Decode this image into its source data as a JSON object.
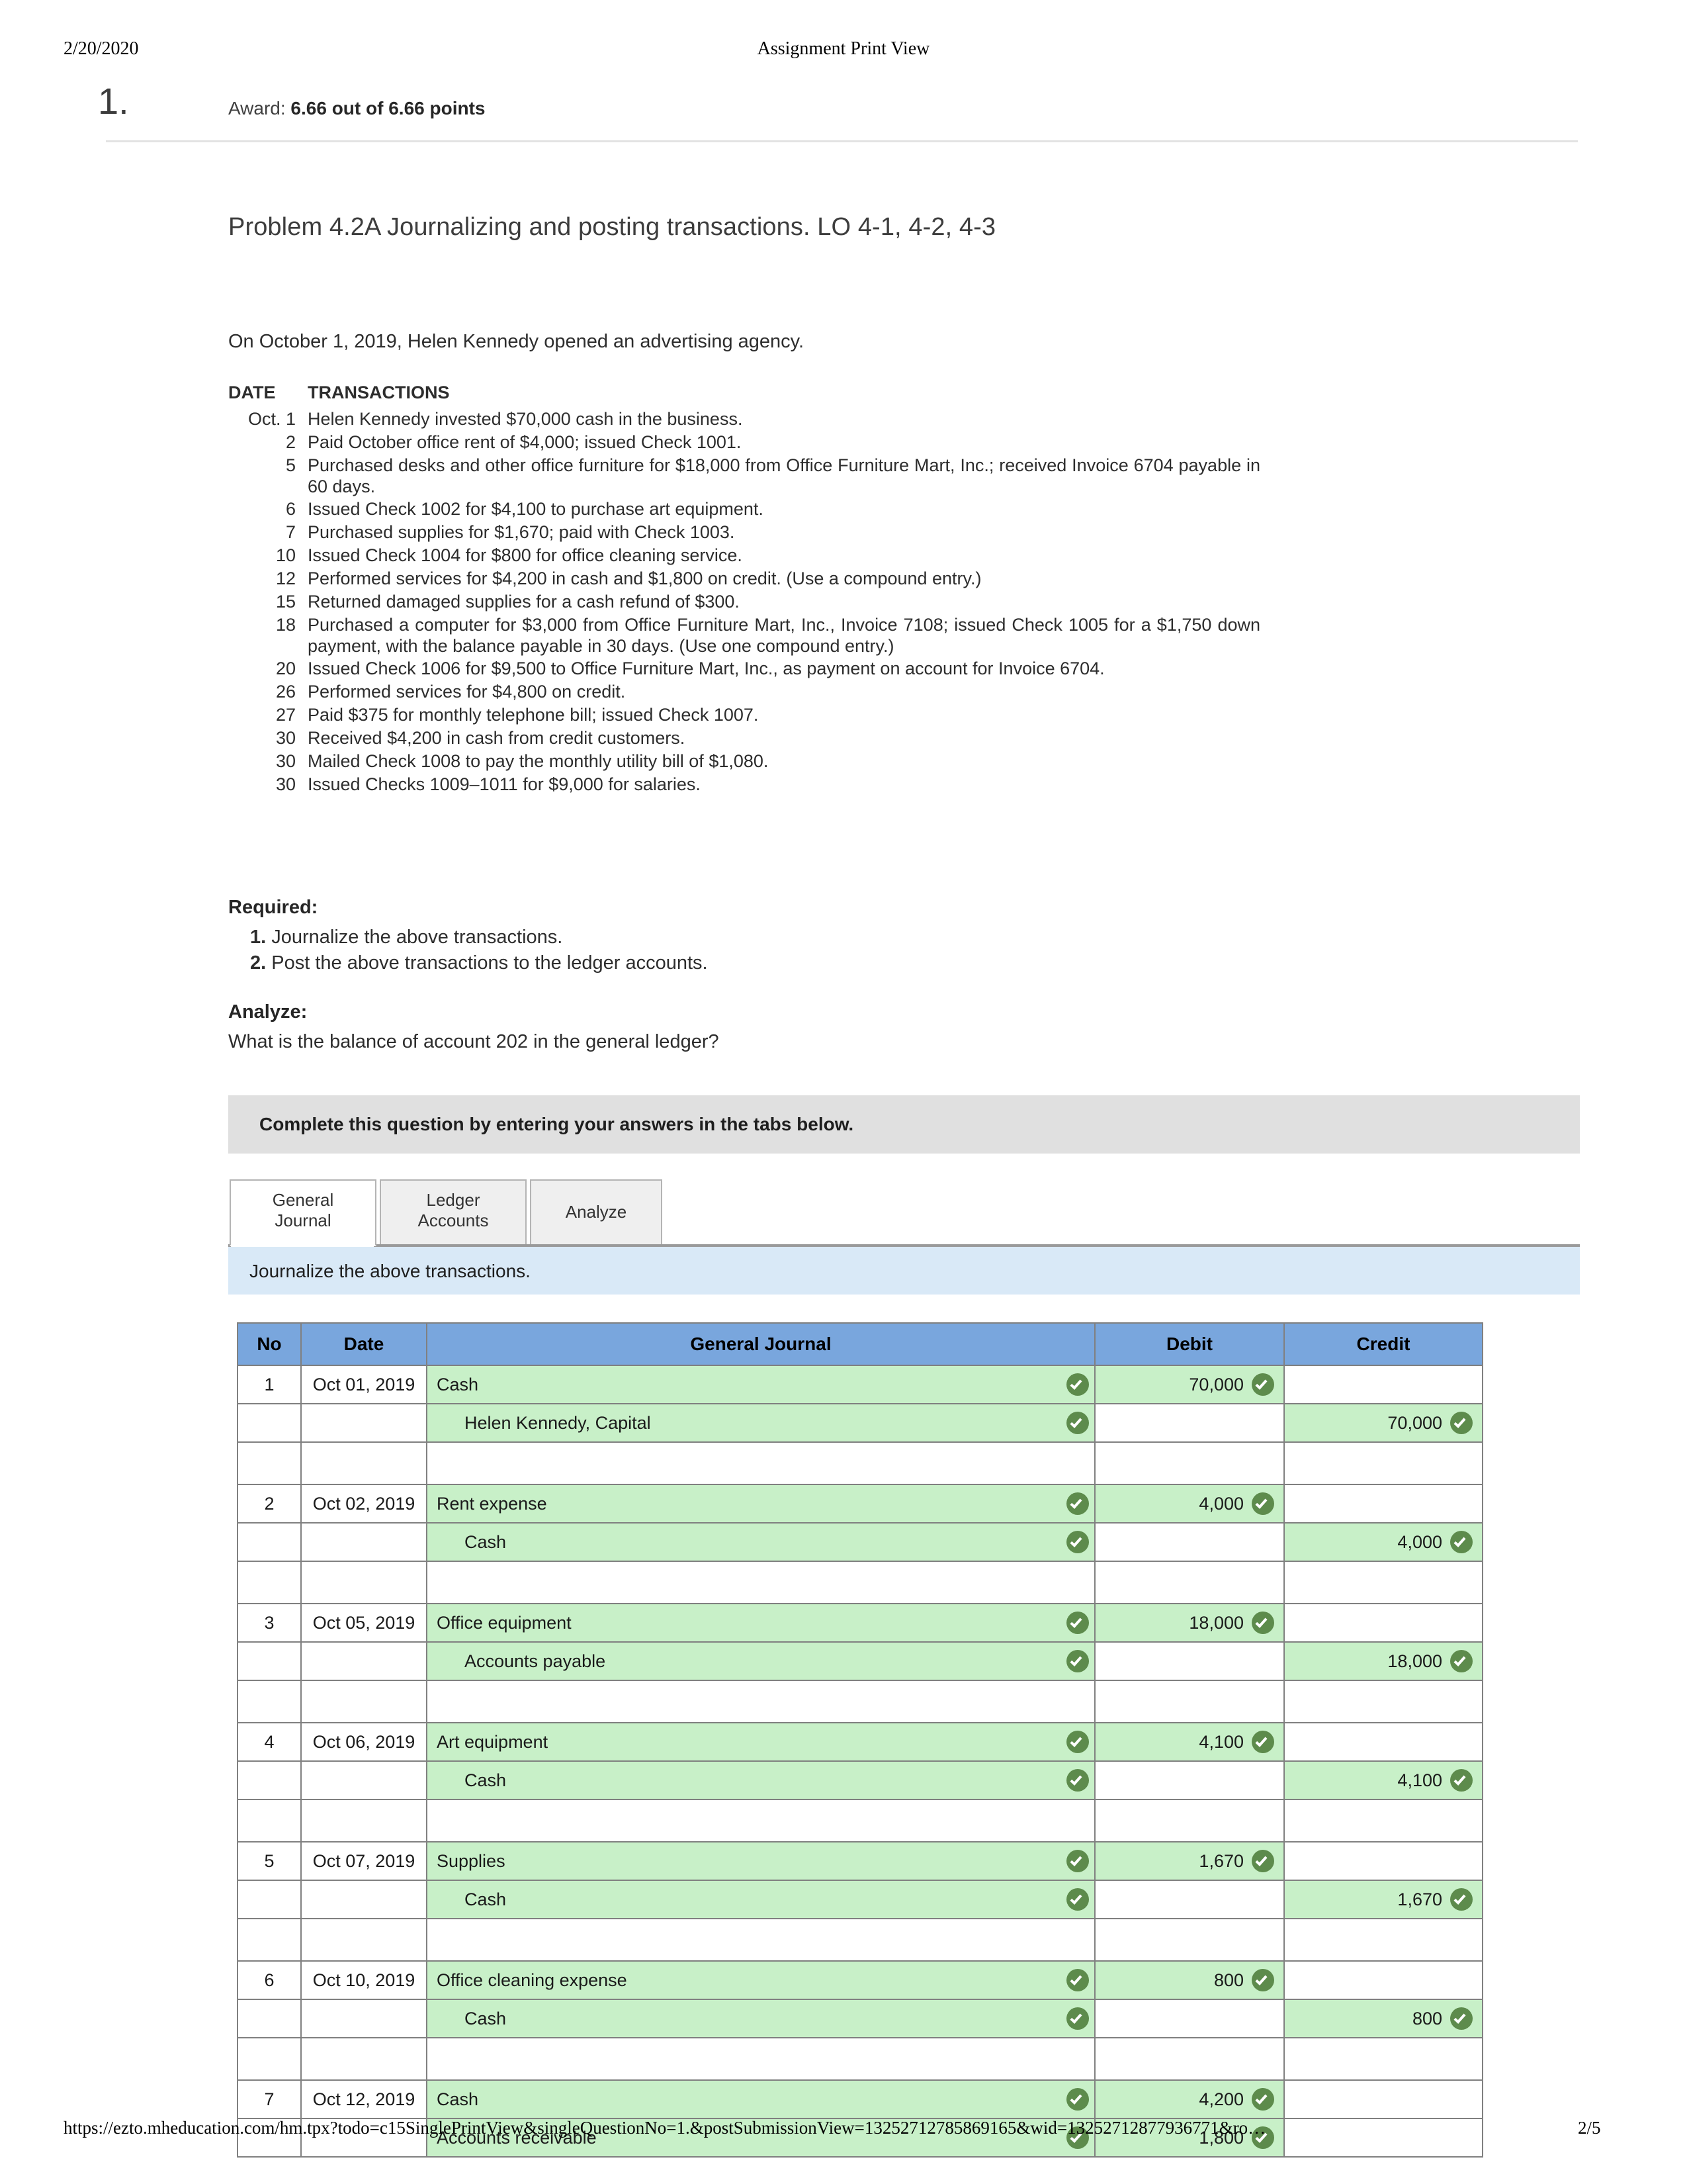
{
  "print_header": {
    "date": "2/20/2020",
    "title": "Assignment Print View"
  },
  "question": {
    "number": "1.",
    "award_label": "Award:",
    "award_value": "6.66 out of 6.66 points"
  },
  "problem": {
    "title": "Problem 4.2A Journalizing and posting transactions. LO 4-1, 4-2, 4-3",
    "intro": "On October 1, 2019, Helen Kennedy opened an advertising agency.",
    "tx_header_date": "DATE",
    "tx_header_transactions": "TRANSACTIONS",
    "transactions": [
      {
        "date": "Oct. 1",
        "text": "Helen Kennedy invested $70,000 cash in the business."
      },
      {
        "date": "2",
        "text": "Paid October office rent of $4,000; issued Check 1001."
      },
      {
        "date": "5",
        "text": "Purchased desks and other office furniture for $18,000 from Office Furniture Mart, Inc.; received Invoice 6704 payable in 60 days."
      },
      {
        "date": "6",
        "text": "Issued Check 1002 for $4,100 to purchase art equipment."
      },
      {
        "date": "7",
        "text": "Purchased supplies for $1,670; paid with Check 1003."
      },
      {
        "date": "10",
        "text": "Issued Check 1004 for $800 for office cleaning service."
      },
      {
        "date": "12",
        "text": "Performed services for $4,200 in cash and $1,800 on credit. (Use a compound entry.)"
      },
      {
        "date": "15",
        "text": "Returned damaged supplies for a cash refund of $300."
      },
      {
        "date": "18",
        "text": "Purchased a computer for $3,000 from Office Furniture Mart, Inc., Invoice 7108; issued Check 1005 for a $1,750 down payment, with the balance payable in 30 days. (Use one compound entry.)"
      },
      {
        "date": "20",
        "text": "Issued Check 1006 for $9,500 to Office Furniture Mart, Inc., as payment on account for Invoice 6704."
      },
      {
        "date": "26",
        "text": "Performed services for $4,800 on credit."
      },
      {
        "date": "27",
        "text": "Paid $375 for monthly telephone bill; issued Check 1007."
      },
      {
        "date": "30",
        "text": "Received $4,200 in cash from credit customers."
      },
      {
        "date": "30",
        "text": "Mailed Check 1008 to pay the monthly utility bill of $1,080."
      },
      {
        "date": "30",
        "text": "Issued Checks 1009–1011 for $9,000 for salaries."
      }
    ],
    "required_heading": "Required:",
    "required_items": [
      {
        "num": "1.",
        "text": "Journalize the above transactions."
      },
      {
        "num": "2.",
        "text": "Post the above transactions to the ledger accounts."
      }
    ],
    "analyze_heading": "Analyze:",
    "analyze_text": "What is the balance of account 202 in the general ledger?"
  },
  "answer_area": {
    "grey_banner": "Complete this question by entering your answers in the tabs below.",
    "tabs": [
      {
        "label_line1": "General",
        "label_line2": "Journal",
        "active": true
      },
      {
        "label_line1": "Ledger",
        "label_line2": "Accounts",
        "active": false
      },
      {
        "label_line1": "Analyze",
        "label_line2": "",
        "active": false
      }
    ],
    "blue_strip": "Journalize the above transactions."
  },
  "journal_table": {
    "columns": [
      "No",
      "Date",
      "General Journal",
      "Debit",
      "Credit"
    ],
    "rows": [
      {
        "type": "entry",
        "no": "1",
        "date": "Oct 01, 2019",
        "account": "Cash",
        "indent": false,
        "debit": "70,000",
        "credit": "",
        "checked": true
      },
      {
        "type": "entry",
        "no": "",
        "date": "",
        "account": "Helen Kennedy, Capital",
        "indent": true,
        "debit": "",
        "credit": "70,000",
        "checked": true
      },
      {
        "type": "spacer"
      },
      {
        "type": "entry",
        "no": "2",
        "date": "Oct 02, 2019",
        "account": "Rent expense",
        "indent": false,
        "debit": "4,000",
        "credit": "",
        "checked": true
      },
      {
        "type": "entry",
        "no": "",
        "date": "",
        "account": "Cash",
        "indent": true,
        "debit": "",
        "credit": "4,000",
        "checked": true
      },
      {
        "type": "spacer"
      },
      {
        "type": "entry",
        "no": "3",
        "date": "Oct 05, 2019",
        "account": "Office equipment",
        "indent": false,
        "debit": "18,000",
        "credit": "",
        "checked": true
      },
      {
        "type": "entry",
        "no": "",
        "date": "",
        "account": "Accounts payable",
        "indent": true,
        "debit": "",
        "credit": "18,000",
        "checked": true
      },
      {
        "type": "spacer"
      },
      {
        "type": "entry",
        "no": "4",
        "date": "Oct 06, 2019",
        "account": "Art equipment",
        "indent": false,
        "debit": "4,100",
        "credit": "",
        "checked": true
      },
      {
        "type": "entry",
        "no": "",
        "date": "",
        "account": "Cash",
        "indent": true,
        "debit": "",
        "credit": "4,100",
        "checked": true
      },
      {
        "type": "spacer"
      },
      {
        "type": "entry",
        "no": "5",
        "date": "Oct 07, 2019",
        "account": "Supplies",
        "indent": false,
        "debit": "1,670",
        "credit": "",
        "checked": true
      },
      {
        "type": "entry",
        "no": "",
        "date": "",
        "account": "Cash",
        "indent": true,
        "debit": "",
        "credit": "1,670",
        "checked": true
      },
      {
        "type": "spacer"
      },
      {
        "type": "entry",
        "no": "6",
        "date": "Oct 10, 2019",
        "account": "Office cleaning expense",
        "indent": false,
        "debit": "800",
        "credit": "",
        "checked": true
      },
      {
        "type": "entry",
        "no": "",
        "date": "",
        "account": "Cash",
        "indent": true,
        "debit": "",
        "credit": "800",
        "checked": true
      },
      {
        "type": "spacer"
      },
      {
        "type": "entry",
        "no": "7",
        "date": "Oct 12, 2019",
        "account": "Cash",
        "indent": false,
        "debit": "4,200",
        "credit": "",
        "checked": true
      },
      {
        "type": "entry",
        "no": "",
        "date": "",
        "account": "Accounts receivable",
        "indent": false,
        "debit": "1,800",
        "credit": "",
        "checked": true
      }
    ]
  },
  "footer": {
    "url": "https://ezto.mheducation.com/hm.tpx?todo=c15SinglePrintView&singleQuestionNo=1.&postSubmissionView=13252712785869165&wid=13252712877936771&ro…",
    "page": "2/5"
  },
  "colors": {
    "table_header_blue": "#79a6dd",
    "row_green": "#c8f0c8",
    "check_green": "#5d8b4c",
    "banner_grey": "#e0e0e0",
    "strip_blue": "#d9e9f7"
  }
}
